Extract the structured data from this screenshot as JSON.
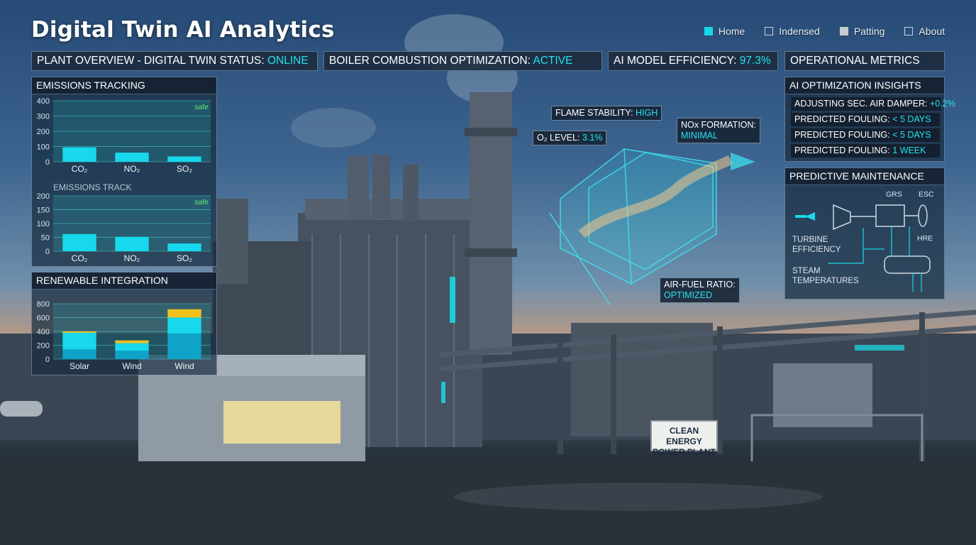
{
  "app": {
    "title": "Digital Twin AI Analytics"
  },
  "nav": [
    {
      "label": "Home",
      "state": "on"
    },
    {
      "label": "Indensed",
      "state": "off"
    },
    {
      "label": "Patting",
      "state": "gray"
    },
    {
      "label": "About",
      "state": "off"
    }
  ],
  "status_bars": {
    "plant": {
      "label": "PLANT OVERVIEW - DIGITAL TWIN STATUS: ",
      "value": "ONLINE"
    },
    "boiler": {
      "label": "BOILER COMBUSTION OPTIMIZATION: ",
      "value": "ACTIVE"
    },
    "ai": {
      "label": "AI MODEL EFFICIENCY: ",
      "value": "97.3%"
    },
    "metrics": {
      "label": "OPERATIONAL METRICS"
    }
  },
  "emissions": {
    "title": "EMISSIONS TRACKING",
    "subtitle": "EMISSIONS TRACK"
  },
  "renewable": {
    "title": "RENEWABLE INTEGRATION"
  },
  "insights": {
    "title": "AI OPTIMIZATION INSIGHTS",
    "rows": [
      {
        "label": "ADJUSTING SEC. AIR DAMPER: ",
        "value": "+0.2%"
      },
      {
        "label": "PREDICTED FOULING: ",
        "value": "< 5 DAYS"
      },
      {
        "label": "PREDICTED FOULING: ",
        "value": "< 5 DAYS"
      },
      {
        "label": "PREDICTED FOULING: ",
        "value": "1 WEEK"
      }
    ]
  },
  "maintenance": {
    "title": "PREDICTIVE MAINTENANCE",
    "labels": {
      "grs": "GRS",
      "esc": "ESC",
      "hre": "HRE",
      "turbine_1": "TURBINE",
      "turbine_2": "EFFICIENCY",
      "steam_1": "STEAM",
      "steam_2": "TEMPERATURES"
    }
  },
  "callouts": {
    "flame": {
      "label": "FLAME STABILITY: ",
      "value": "HIGH"
    },
    "nox": {
      "label": "NOx FORMATION:",
      "value": "MINIMAL"
    },
    "o2": {
      "label": "O₂ LEVEL: ",
      "value": "3.1%"
    },
    "airfuel": {
      "label": "AIR-FUEL RATIO:",
      "value": "OPTIMIZED"
    }
  },
  "sign": {
    "line1": "CLEAN ENERGY",
    "line2": "POWER PLANT"
  },
  "colors": {
    "accent": "#27e0ee",
    "bar_main": "#17d8ec",
    "bar_mid": "#0fa3c8",
    "bar_top": "#f1c21b"
  },
  "chart_data": [
    {
      "type": "bar",
      "categories": [
        "CO₂",
        "NO₂",
        "SO₂"
      ],
      "values": [
        95,
        60,
        35
      ],
      "ylim": [
        0,
        400
      ],
      "yticks": [
        0,
        100,
        200,
        300,
        400
      ],
      "annotation": "safe",
      "grid": true
    },
    {
      "type": "bar",
      "title": "EMISSIONS TRACK",
      "categories": [
        "CO₂",
        "NO₂",
        "SO₂"
      ],
      "values": [
        62,
        52,
        28
      ],
      "ylim": [
        0,
        200
      ],
      "yticks": [
        0,
        50,
        100,
        150,
        200
      ],
      "annotation": "safe",
      "grid": true
    },
    {
      "type": "bar",
      "stacked": true,
      "categories": [
        "Solar",
        "Wind",
        "Wind"
      ],
      "series": [
        {
          "values": [
            140,
            120,
            370
          ]
        },
        {
          "values": [
            240,
            110,
            230
          ]
        },
        {
          "values": [
            20,
            40,
            120
          ]
        }
      ],
      "ylim": [
        0,
        800
      ],
      "yticks": [
        0,
        200,
        400,
        600,
        800
      ],
      "grid": true
    }
  ]
}
